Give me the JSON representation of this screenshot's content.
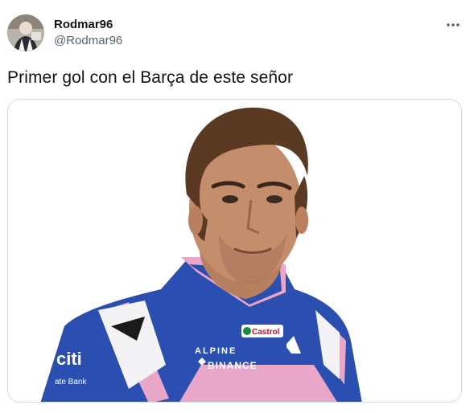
{
  "author": {
    "display_name": "Rodmar96",
    "handle": "@Rodmar96",
    "avatar_icon": "user-avatar-photo"
  },
  "more_icon": "more-dots-icon",
  "tweet": {
    "text": "Primer gol con el Barça de este señor"
  },
  "media": {
    "suit_brand_alpine": "ALPINE",
    "suit_brand_binance": "BINANCE",
    "suit_brand_castrol": "Castrol",
    "suit_brand_citi": "citi",
    "suit_brand_citi_sub": "ate Bank",
    "colors": {
      "suit_blue": "#2a4fb0",
      "suit_pink": "#e8a6c8",
      "hair": "#5b3a23",
      "skin": "#c48d6b"
    }
  }
}
